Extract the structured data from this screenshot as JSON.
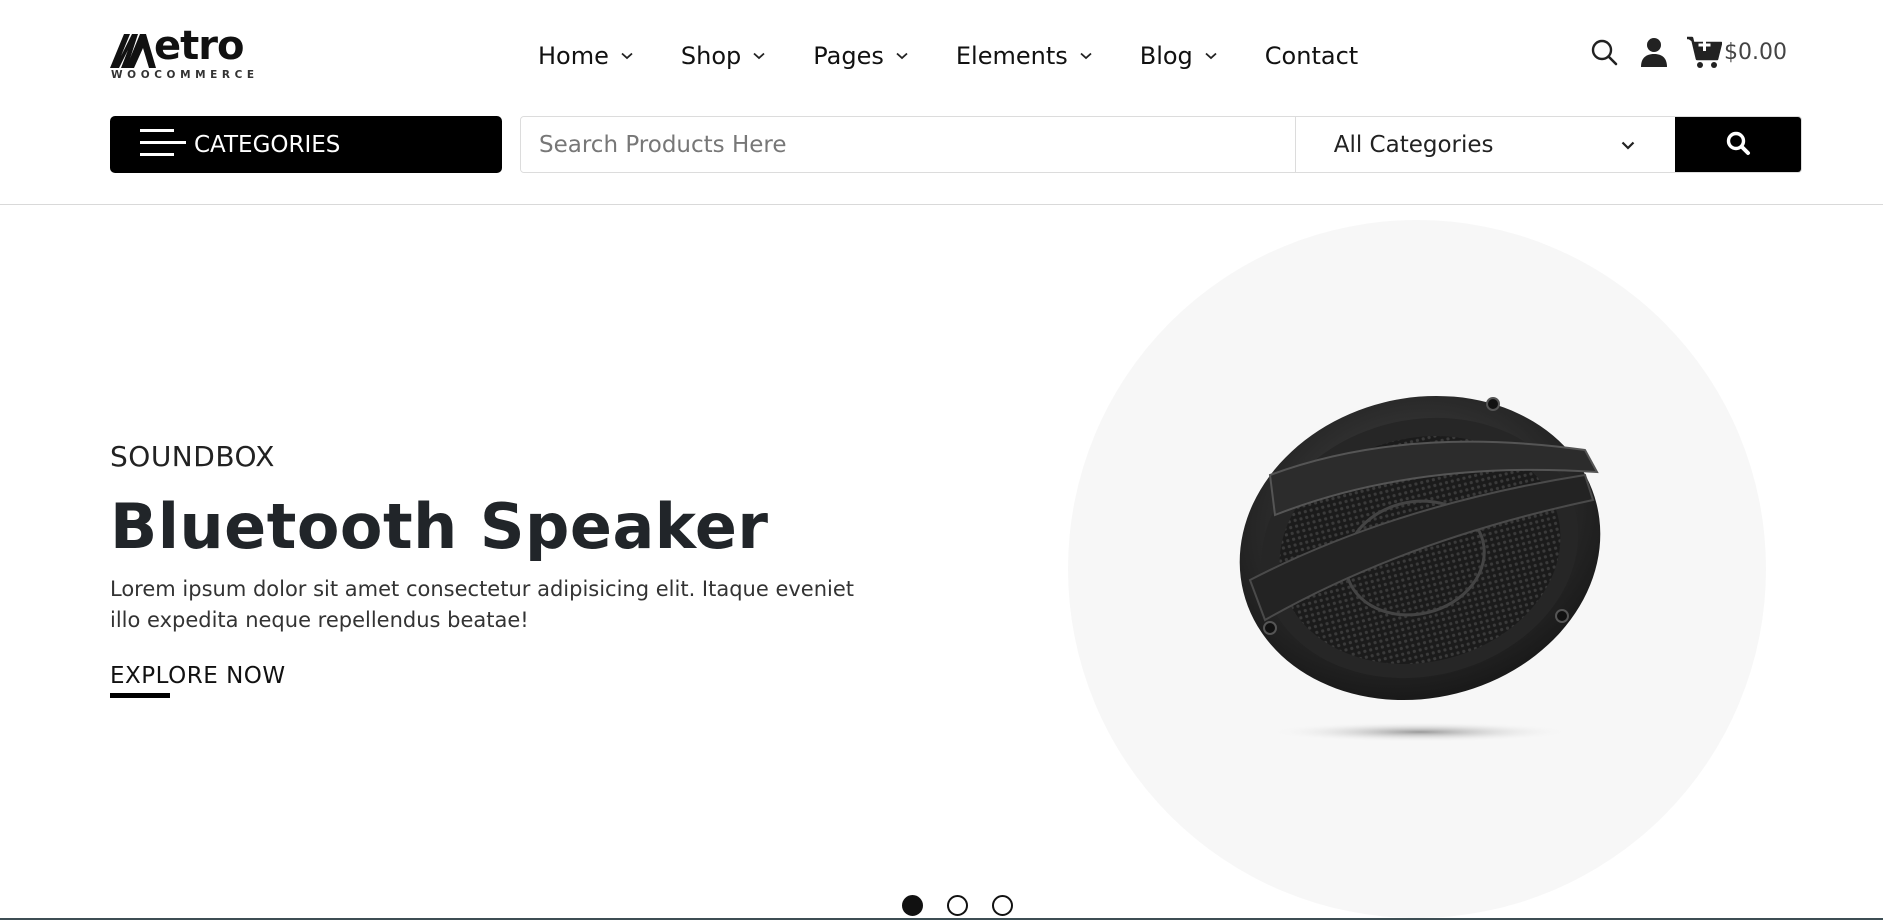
{
  "logo": {
    "word": "etro",
    "letter": "M",
    "sub": "WOOCOMMERCE"
  },
  "nav": {
    "items": [
      {
        "label": "Home",
        "dropdown": true
      },
      {
        "label": "Shop",
        "dropdown": true
      },
      {
        "label": "Pages",
        "dropdown": true
      },
      {
        "label": "Elements",
        "dropdown": true
      },
      {
        "label": "Blog",
        "dropdown": true
      },
      {
        "label": "Contact",
        "dropdown": false
      }
    ]
  },
  "header_icons": {
    "search_icon": "search-icon",
    "user_icon": "user-icon",
    "cart_icon": "cart-add-icon",
    "cart_total": "$0.00"
  },
  "categories_button": {
    "label": "CATEGORIES",
    "icon": "hamburger-icon"
  },
  "search": {
    "placeholder": "Search Products Here",
    "value": "",
    "category_selected": "All Categories",
    "button_icon": "search-icon"
  },
  "hero": {
    "subtitle": "SOUNDBOX",
    "title": "Bluetooth Speaker",
    "description": "Lorem ipsum dolor sit amet consectetur adipisicing elit. Itaque eveniet illo expedita neque repellendus beatae!",
    "cta": "EXPLORE NOW",
    "image": "car-speaker-product-image"
  },
  "slider": {
    "slides": 3,
    "active_index": 0
  },
  "colors": {
    "primary": "#000000",
    "text": "#212529",
    "circle_bg": "#f7f7f7",
    "border": "#dcdcdc"
  }
}
